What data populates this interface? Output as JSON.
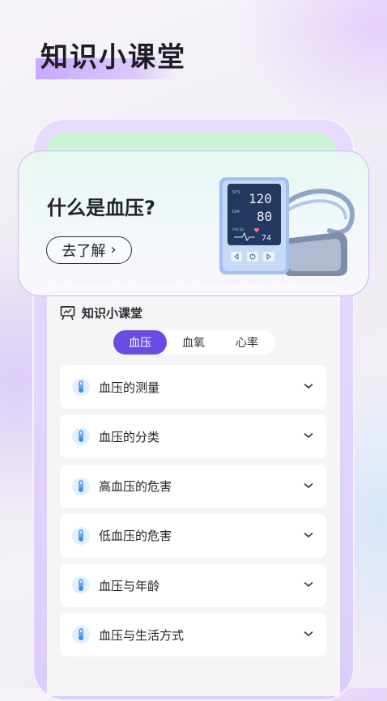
{
  "headline": "知识小课堂",
  "hero": {
    "title": "什么是血压?",
    "button_label": "去了解",
    "monitor": {
      "sys_label": "SYS",
      "sys": "120",
      "dia_label": "DIA",
      "dia": "80",
      "pulse_label": "PULSE",
      "pulse": "74"
    }
  },
  "section": {
    "title": "知识小课堂",
    "icon": "whiteboard-icon"
  },
  "tabs": [
    {
      "label": "血压",
      "active": true
    },
    {
      "label": "血氧",
      "active": false
    },
    {
      "label": "心率",
      "active": false
    }
  ],
  "items": [
    {
      "label": "血压的测量",
      "icon": "thermometer-icon"
    },
    {
      "label": "血压的分类",
      "icon": "thermometer-icon"
    },
    {
      "label": "高血压的危害",
      "icon": "thermometer-icon"
    },
    {
      "label": "低血压的危害",
      "icon": "thermometer-icon"
    },
    {
      "label": "血压与年龄",
      "icon": "thermometer-icon"
    },
    {
      "label": "血压与生活方式",
      "icon": "thermometer-icon"
    }
  ],
  "colors": {
    "accent": "#6b4be2",
    "icon_bg": "#e1effe",
    "icon_fg": "#3d8bf0"
  }
}
